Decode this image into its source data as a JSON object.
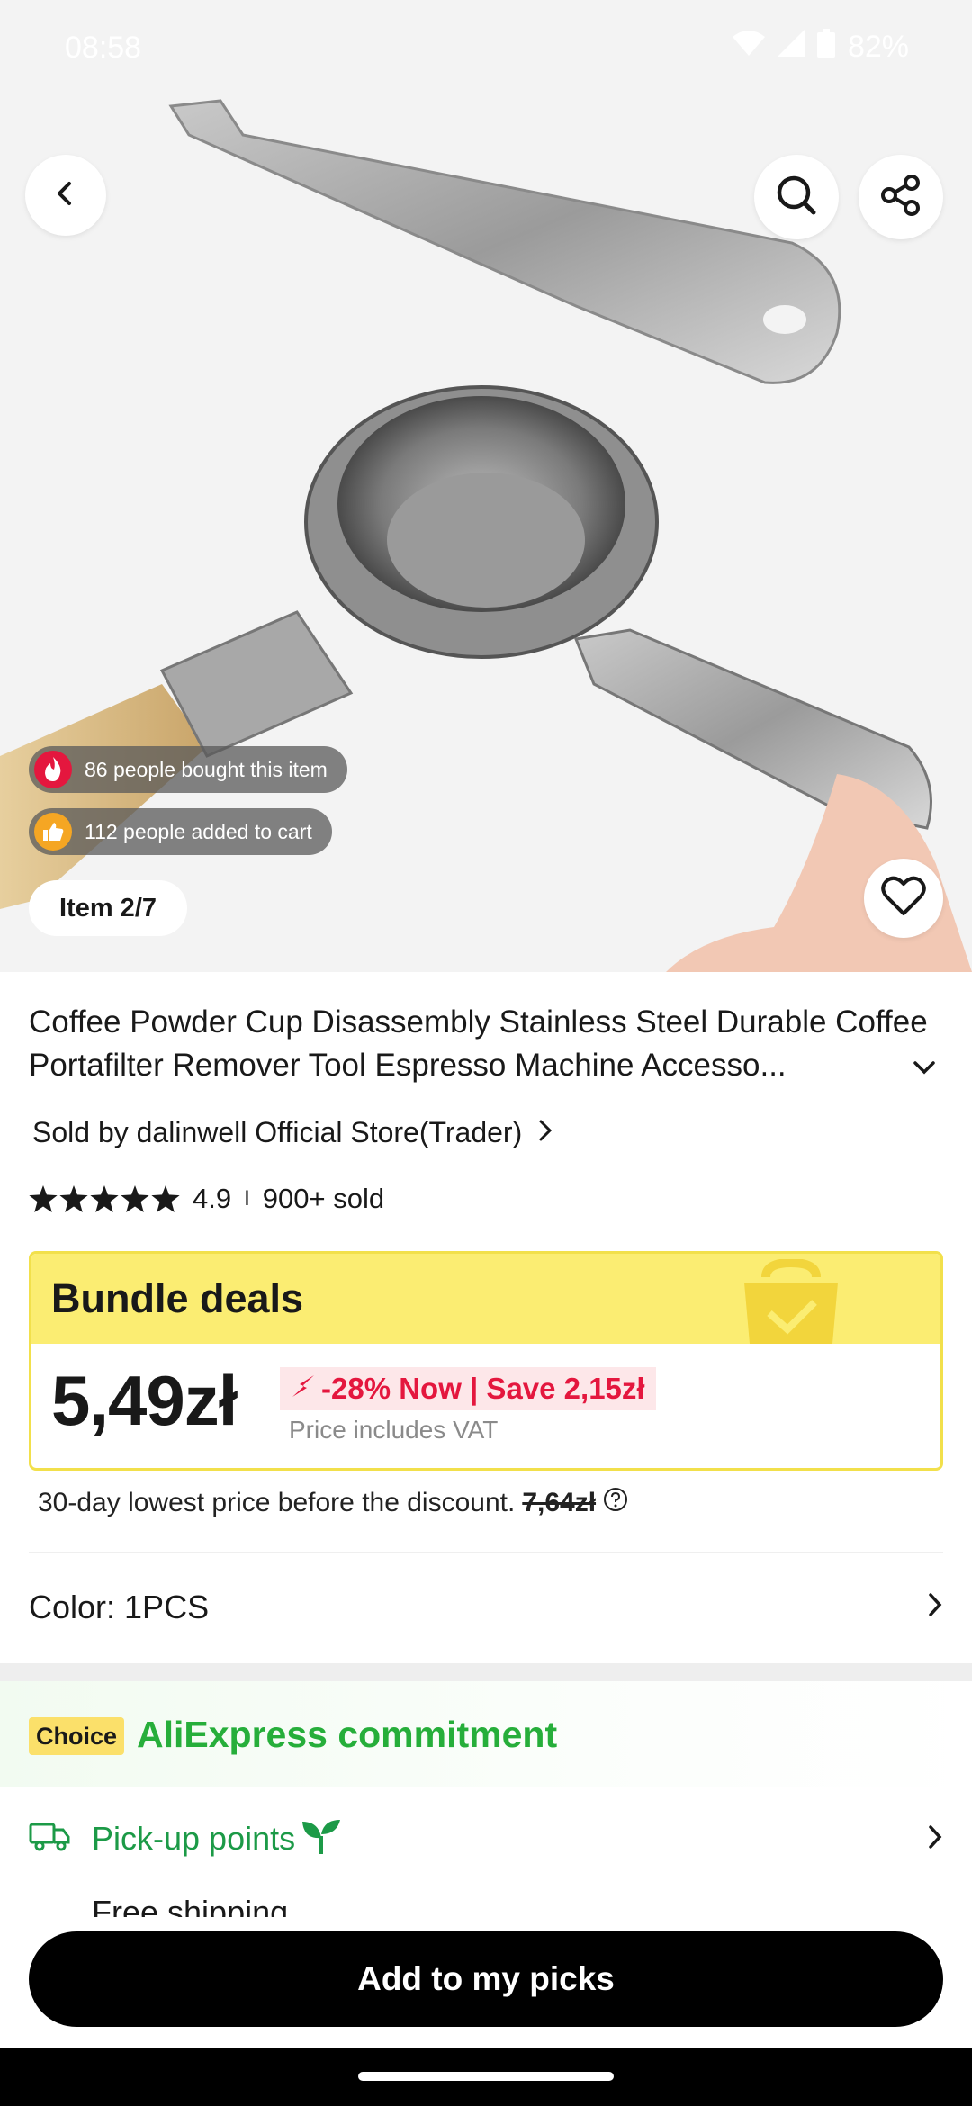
{
  "status_bar": {
    "time": "08:58",
    "battery": "82%"
  },
  "gallery": {
    "social_bought": "86 people bought this item",
    "social_cart": "112 people added to cart",
    "item_counter": "Item 2/7"
  },
  "product": {
    "title": "Coffee Powder Cup Disassembly Stainless Steel Durable Coffee Portafilter Remover Tool Espresso Machine Accesso...",
    "seller": "Sold by dalinwell Official Store(Trader)",
    "rating": "4.9",
    "rating_separator": "I",
    "sold": "900+ sold",
    "stars": 5
  },
  "bundle": {
    "title": "Bundle deals",
    "price": "5,49zł",
    "discount": "-28% Now | Save 2,15zł",
    "vat": "Price includes VAT"
  },
  "lowest_price": {
    "text": "30-day lowest price before the discount.",
    "value": "7,64zł"
  },
  "color": {
    "label": "Color: 1PCS"
  },
  "commitment": {
    "badge": "Choice",
    "title": "AliExpress commitment",
    "pickup": "Pick-up points",
    "free_shipping": "Free shipping"
  },
  "cta": {
    "label": "Add to my picks"
  },
  "colors": {
    "accent_red": "#e4173e",
    "bundle_yellow": "#fbed72",
    "commit_green": "#26ae3a",
    "pickup_green": "#1c9a47"
  }
}
